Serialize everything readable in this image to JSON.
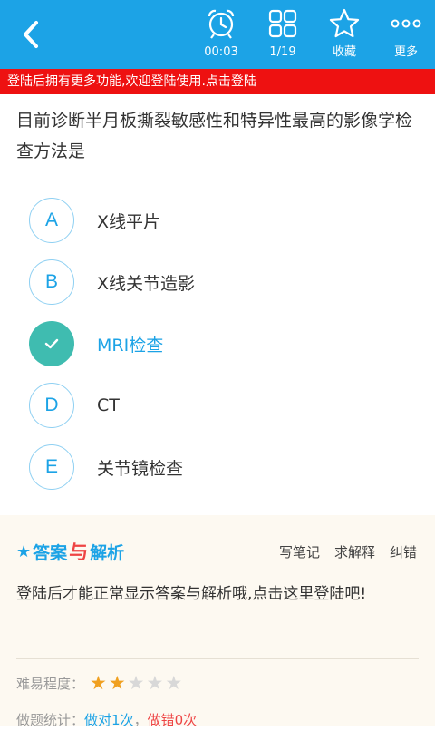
{
  "header": {
    "timer": "00:03",
    "progress": "1/19",
    "favorite_label": "收藏",
    "more_label": "更多"
  },
  "banner": "登陆后拥有更多功能,欢迎登陆使用.点击登陆",
  "question": "目前诊断半月板撕裂敏感性和特异性最高的影像学检查方法是",
  "options": [
    {
      "letter": "A",
      "text": "X线平片"
    },
    {
      "letter": "B",
      "text": "X线关节造影"
    },
    {
      "letter": "C",
      "text": "MRI检查",
      "selected": true
    },
    {
      "letter": "D",
      "text": "CT"
    },
    {
      "letter": "E",
      "text": "关节镜检查"
    }
  ],
  "analysis": {
    "title_part1": "答案",
    "title_part2": "与",
    "title_part3": "解析",
    "actions": [
      "写笔记",
      "求解释",
      "纠错"
    ],
    "notice": "登陆后才能正常显示答案与解析哦,点击这里登陆吧!",
    "difficulty_label": "难易程度：",
    "difficulty_rating": 2,
    "difficulty_max": 5,
    "stats_label": "做题统计：",
    "stats_correct": "做对1次",
    "stats_sep": "，",
    "stats_wrong": "做错0次"
  },
  "colors": {
    "primary": "#1ca3e6",
    "banner": "#ee1111",
    "selected": "#3fbcb0",
    "star_on": "#f0a020",
    "star_off": "#d8d8d8"
  }
}
